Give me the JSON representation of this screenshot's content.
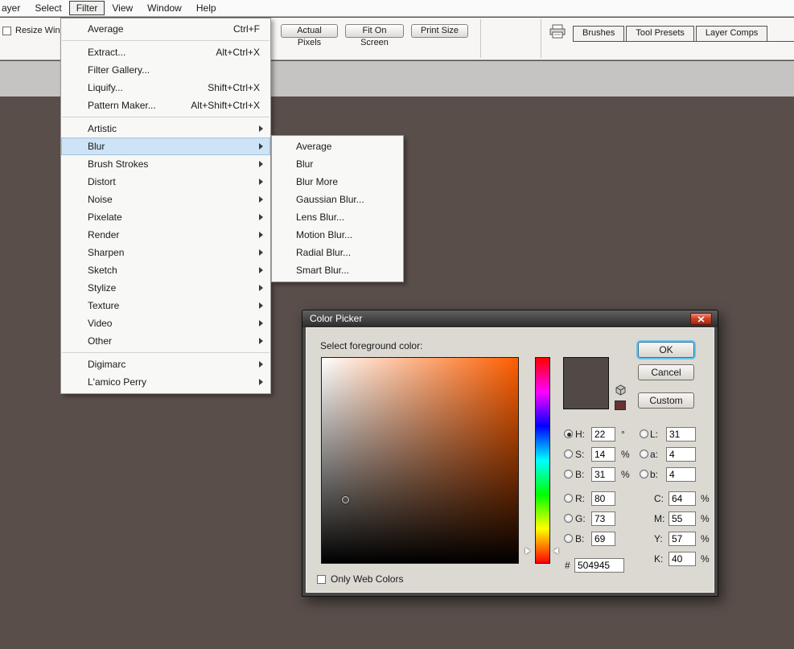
{
  "menu_bar": {
    "items": [
      {
        "label": "ayer"
      },
      {
        "label": "Select"
      },
      {
        "label": "Filter",
        "active": true
      },
      {
        "label": "View"
      },
      {
        "label": "Window"
      },
      {
        "label": "Help"
      }
    ]
  },
  "options_bar": {
    "resize_label": "Resize Window",
    "buttons": [
      "Actual Pixels",
      "Fit On Screen",
      "Print Size"
    ],
    "palette_tabs": [
      "Brushes",
      "Tool Presets",
      "Layer Comps"
    ]
  },
  "filter_menu": {
    "items": [
      {
        "label": "Average",
        "shortcut": "Ctrl+F"
      },
      {
        "separator": true
      },
      {
        "label": "Extract...",
        "shortcut": "Alt+Ctrl+X"
      },
      {
        "label": "Filter Gallery..."
      },
      {
        "label": "Liquify...",
        "shortcut": "Shift+Ctrl+X"
      },
      {
        "label": "Pattern Maker...",
        "shortcut": "Alt+Shift+Ctrl+X"
      },
      {
        "separator": true
      },
      {
        "label": "Artistic",
        "submenu": true
      },
      {
        "label": "Blur",
        "submenu": true,
        "highlighted": true
      },
      {
        "label": "Brush Strokes",
        "submenu": true
      },
      {
        "label": "Distort",
        "submenu": true
      },
      {
        "label": "Noise",
        "submenu": true
      },
      {
        "label": "Pixelate",
        "submenu": true
      },
      {
        "label": "Render",
        "submenu": true
      },
      {
        "label": "Sharpen",
        "submenu": true
      },
      {
        "label": "Sketch",
        "submenu": true
      },
      {
        "label": "Stylize",
        "submenu": true
      },
      {
        "label": "Texture",
        "submenu": true
      },
      {
        "label": "Video",
        "submenu": true
      },
      {
        "label": "Other",
        "submenu": true
      },
      {
        "separator": true
      },
      {
        "label": "Digimarc",
        "submenu": true
      },
      {
        "label": "L'amico Perry",
        "submenu": true
      }
    ]
  },
  "blur_submenu": {
    "items": [
      "Average",
      "Blur",
      "Blur More",
      "Gaussian Blur...",
      "Lens Blur...",
      "Motion Blur...",
      "Radial Blur...",
      "Smart Blur..."
    ]
  },
  "color_picker": {
    "title": "Color Picker",
    "subtitle": "Select foreground color:",
    "ok_label": "OK",
    "cancel_label": "Cancel",
    "custom_label": "Custom",
    "only_web_colors_label": "Only Web Colors",
    "fields": {
      "h": {
        "label": "H:",
        "value": "22",
        "unit": "°"
      },
      "s": {
        "label": "S:",
        "value": "14",
        "unit": "%"
      },
      "b_hsb": {
        "label": "B:",
        "value": "31",
        "unit": "%"
      },
      "r": {
        "label": "R:",
        "value": "80"
      },
      "g": {
        "label": "G:",
        "value": "73"
      },
      "b_rgb": {
        "label": "B:",
        "value": "69"
      },
      "l": {
        "label": "L:",
        "value": "31"
      },
      "a": {
        "label": "a:",
        "value": "4"
      },
      "b_lab": {
        "label": "b:",
        "value": "4"
      },
      "c": {
        "label": "C:",
        "value": "64",
        "unit": "%"
      },
      "m": {
        "label": "M:",
        "value": "55",
        "unit": "%"
      },
      "y": {
        "label": "Y:",
        "value": "57",
        "unit": "%"
      },
      "k": {
        "label": "K:",
        "value": "40",
        "unit": "%"
      },
      "hex": {
        "label": "#",
        "value": "504945"
      }
    },
    "colors": {
      "current": "#504945",
      "web_safe": "#663333",
      "hue_degrees": 22,
      "ok_focus_ring": "#66C6EE"
    }
  },
  "colors": {
    "canvas_bg": "#594E4A",
    "menu_highlight": "#CDE3F6"
  },
  "icons": {
    "close": "x-cross",
    "printer": "printer",
    "web_safe_warning": "cube",
    "submenu_arrow": "right-triangle"
  }
}
